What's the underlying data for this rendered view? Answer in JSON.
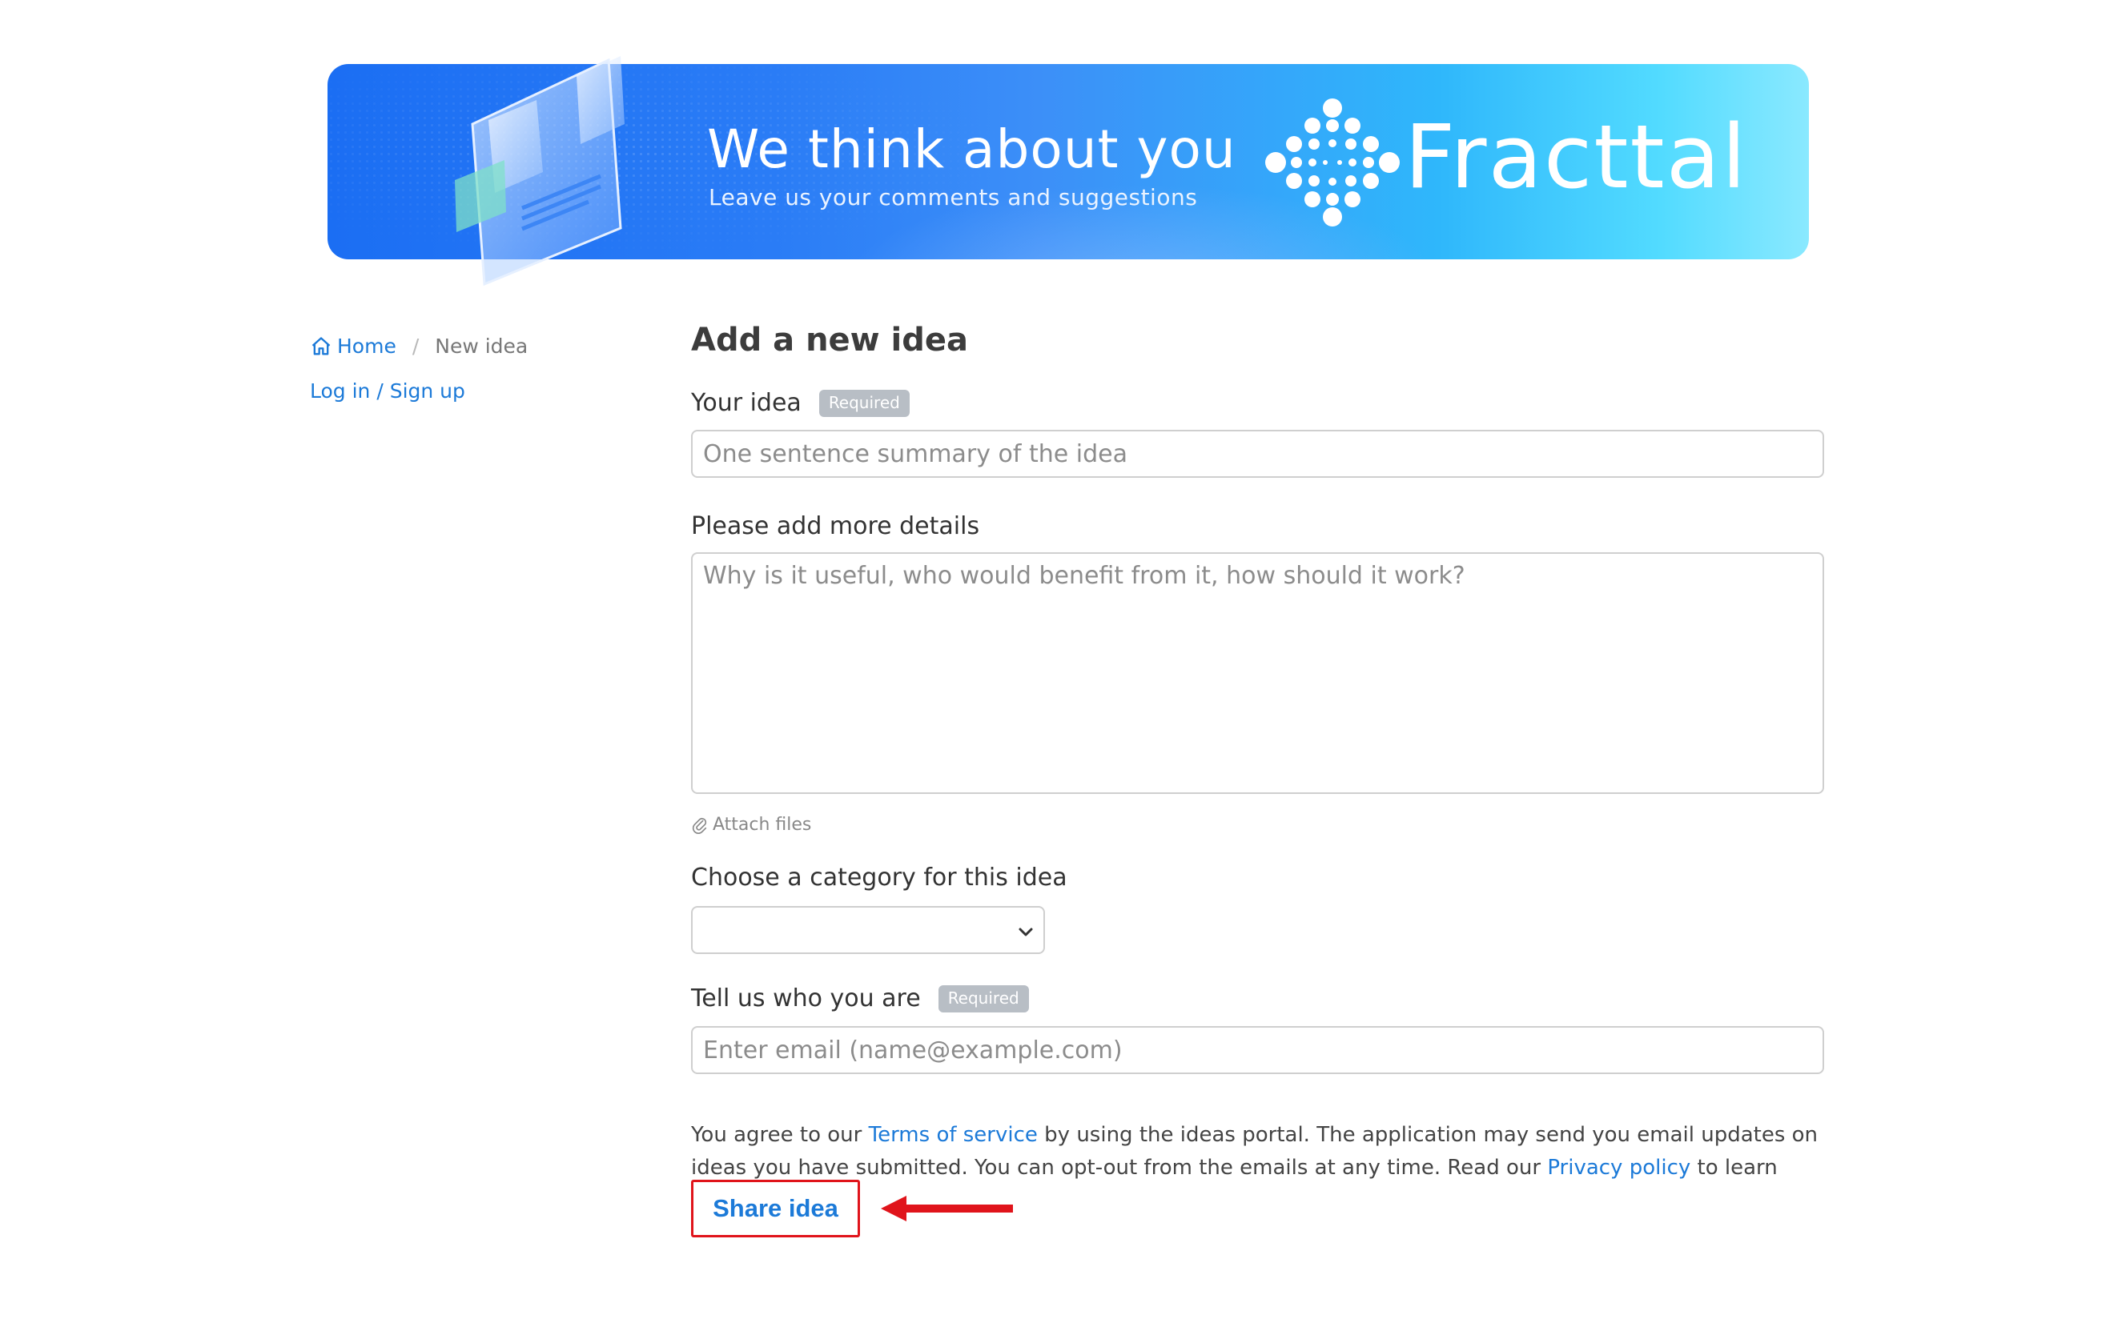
{
  "banner": {
    "title": "We think about you",
    "subtitle": "Leave us your comments and suggestions",
    "brand": "Fracttal",
    "logo_icon": "fracttal-dots-logo",
    "gradient_colors": [
      "#1b6ef3",
      "#52dbff"
    ]
  },
  "sidebar": {
    "breadcrumb": {
      "home_icon": "home-icon",
      "home_label": "Home",
      "separator": "/",
      "current": "New idea"
    },
    "login_label": "Log in / Sign up"
  },
  "form": {
    "title": "Add a new idea",
    "idea": {
      "label": "Your idea",
      "badge": "Required",
      "value": "",
      "placeholder": "One sentence summary of the idea"
    },
    "details": {
      "label": "Please add more details",
      "value": "",
      "placeholder": "Why is it useful, who would benefit from it, how should it work?"
    },
    "attach_label": "Attach files",
    "category": {
      "label": "Choose a category for this idea",
      "selected": ""
    },
    "identity": {
      "label": "Tell us who you are",
      "badge": "Required",
      "value": "",
      "placeholder": "Enter email (name@example.com)"
    },
    "terms": {
      "text_1": "You agree to our ",
      "terms_link": "Terms of service",
      "text_2": " by using the ideas portal. The application may send you email updates on ideas you have submitted. You can opt-out from the emails at any time. Read our ",
      "privacy_link": "Privacy policy",
      "text_3": " to learn more."
    },
    "submit_label": "Share idea"
  },
  "colors": {
    "link": "#1c7ad8",
    "highlight": "#e0141b",
    "badge": "#b8bec5"
  }
}
